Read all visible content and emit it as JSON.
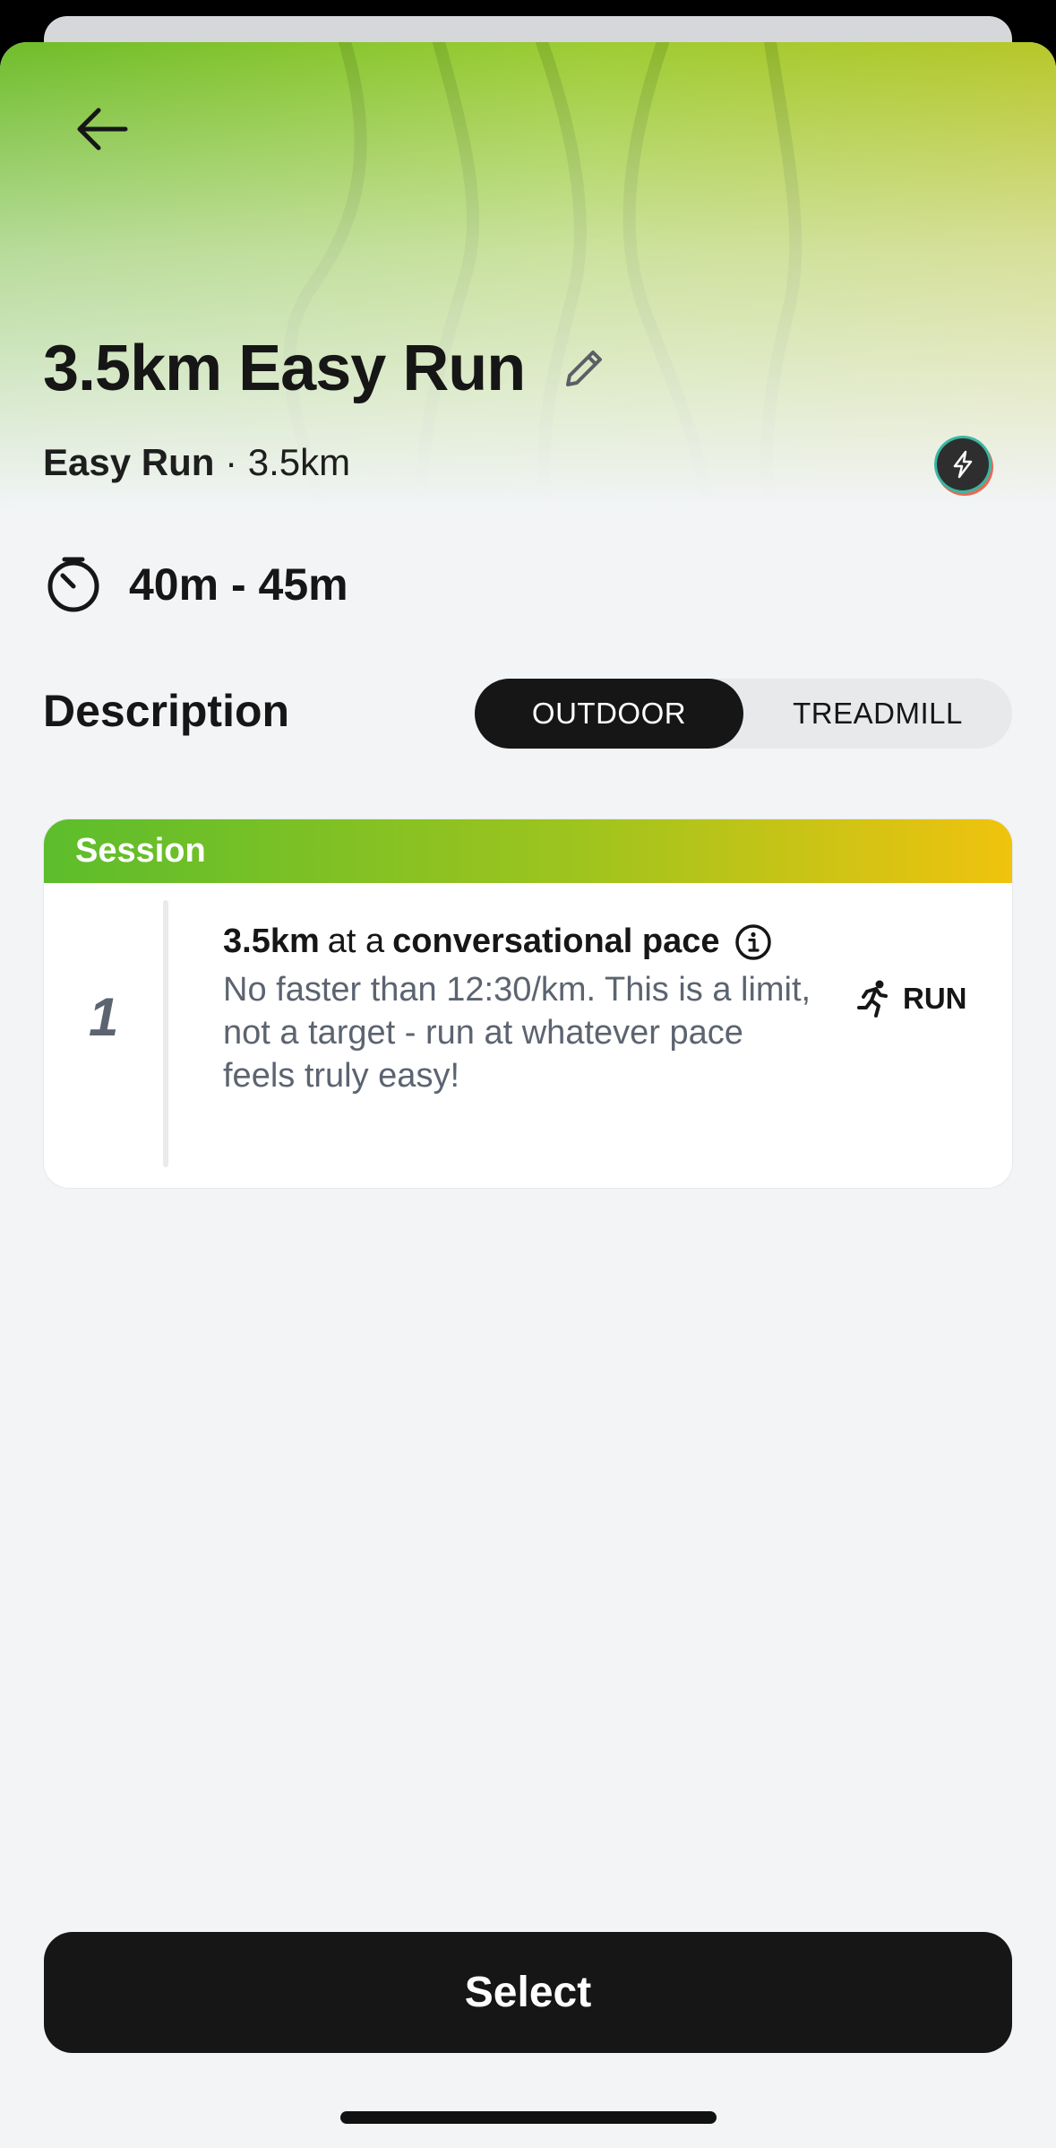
{
  "header": {
    "back_icon": "arrow-left-icon"
  },
  "workout": {
    "title": "3.5km Easy Run",
    "edit_icon": "pencil-icon",
    "type": "Easy Run",
    "separator": "·",
    "distance": "3.5km",
    "badge_icon": "lightning-bolt-icon",
    "duration_icon": "stopwatch-icon",
    "duration": "40m - 45m"
  },
  "description": {
    "label": "Description",
    "toggle": {
      "options": [
        "OUTDOOR",
        "TREADMILL"
      ],
      "selected": "OUTDOOR"
    }
  },
  "session": {
    "heading": "Session",
    "steps": [
      {
        "number": "1",
        "distance": "3.5km",
        "connector": "at a",
        "pace_label": "conversational pace",
        "info_icon": "info-circle-icon",
        "detail": "No faster than 12:30/km. This is a limit, not a target - run at whatever pace feels truly easy!",
        "activity_icon": "running-person-icon",
        "activity": "RUN"
      }
    ]
  },
  "footer": {
    "select_label": "Select"
  },
  "colors": {
    "hero_start": "#6fbd2a",
    "hero_end": "#b7c729",
    "session_gradient_start": "#5cbd2c",
    "session_gradient_end": "#f0c30e",
    "primary_dark": "#161616",
    "background": "#f2f4f6"
  }
}
